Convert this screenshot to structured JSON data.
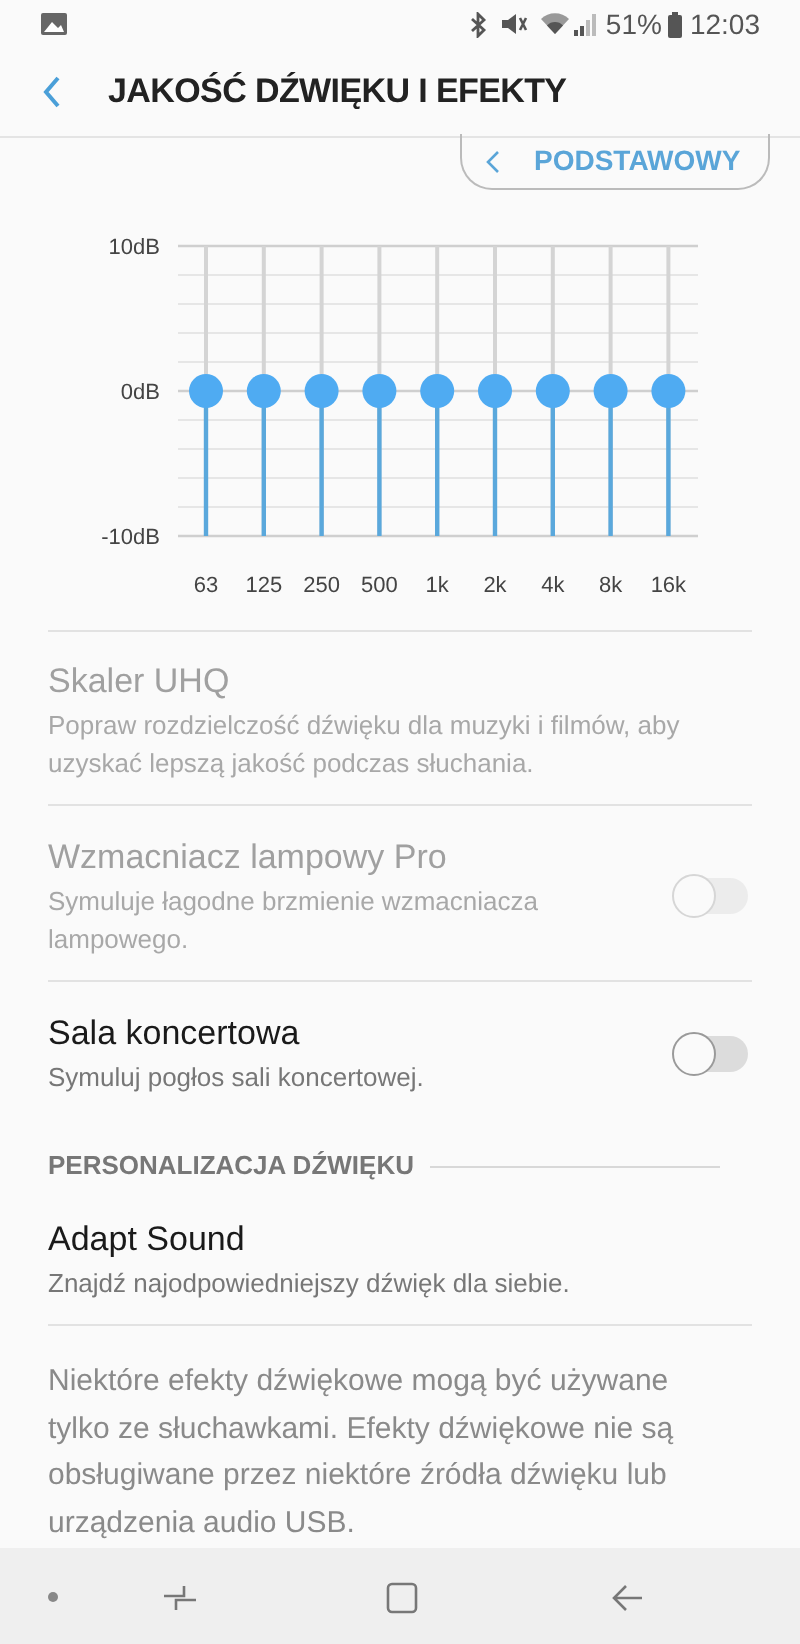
{
  "status_bar": {
    "battery": "51%",
    "time": "12:03"
  },
  "header": {
    "title": "JAKOŚĆ DŹWIĘKU I EFEKTY"
  },
  "preset_button": {
    "label": "PODSTAWOWY"
  },
  "equalizer": {
    "chart_data": {
      "type": "scatter",
      "categories": [
        "63",
        "125",
        "250",
        "500",
        "1k",
        "2k",
        "4k",
        "8k",
        "16k"
      ],
      "grid": true,
      "series": [
        {
          "color": "#4fabf2",
          "values": [
            0,
            0,
            0,
            0,
            0,
            0,
            0,
            0,
            0
          ]
        }
      ],
      "ylim": [
        -10,
        10
      ],
      "yticks": [
        {
          "value": 10,
          "label": "10dB"
        },
        {
          "value": 0,
          "label": "0dB"
        },
        {
          "value": -10,
          "label": "-10dB"
        }
      ]
    }
  },
  "settings": [
    {
      "kind": "text",
      "title": "Skaler UHQ",
      "description": "Popraw rozdzielczość dźwięku dla muzyki i filmów, aby uzyskać lepszą jakość podczas słuchania.",
      "disabled": true
    },
    {
      "kind": "switch",
      "title": "Wzmacniacz lampowy Pro",
      "description": "Symuluje łagodne brzmienie wzmacniacza lampowego.",
      "disabled": true,
      "on": false
    },
    {
      "kind": "switch",
      "title": "Sala koncertowa",
      "description": "Symuluj pogłos sali koncertowej.",
      "disabled": false,
      "on": false
    }
  ],
  "section": {
    "title": "PERSONALIZACJA DŹWIĘKU",
    "items": [
      {
        "title": "Adapt Sound",
        "description": "Znajdź najodpowiedniejszy dźwięk dla siebie."
      }
    ]
  },
  "note": "Niektóre efekty dźwiękowe mogą być używane tylko ze słuchawkami. Efekty dźwiękowe nie są obsługiwane przez niektóre źródła dźwięku lub urządzenia audio USB."
}
